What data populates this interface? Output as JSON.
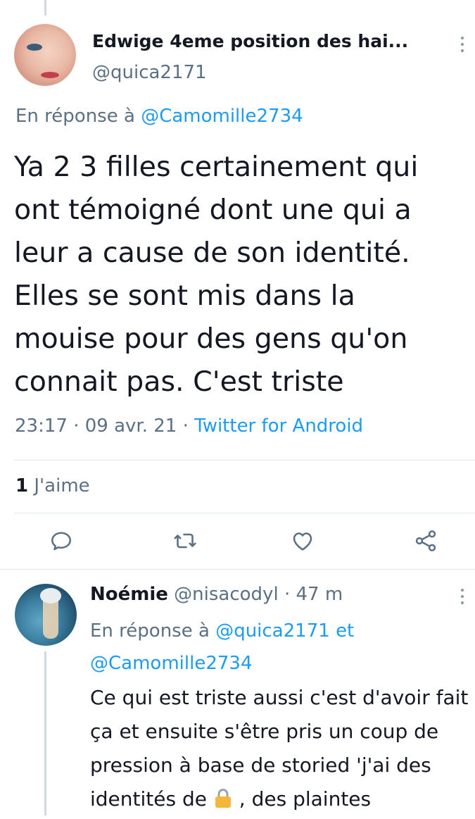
{
  "tweet": {
    "author_name": "Edwige 4eme position des hai...",
    "author_handle": "@quica2171",
    "reply_prefix": "En réponse à",
    "reply_mention": "@Camomille2734",
    "text": "Ya 2 3 filles certainement qui\nont témoigné dont une qui a\nleur a cause de son identité.\nElles se sont mis dans la\nmouise pour des gens qu'on\nconnait pas. C'est triste",
    "time": "23:17 · 09 avr. 21 · ",
    "source": "Twitter for Android",
    "likes_count": "1",
    "likes_label": "J'aime",
    "icons": {
      "more": "more-vertical-icon",
      "reply": "reply-icon",
      "retweet": "retweet-icon",
      "like": "heart-icon",
      "share": "share-icon"
    }
  },
  "reply": {
    "author_name": "Noémie",
    "author_handle": "@nisacodyl",
    "time": "· 47 m",
    "reply_prefix": "En réponse à",
    "reply_mention_1": "@quica2171",
    "reply_connector": "et",
    "reply_mention_2": "@Camomille2734",
    "text_before_emoji": "Ce qui est triste aussi c'est d'avoir fait ça et ensuite s'être pris un coup de pression à base de storied 'j'ai des identités de ",
    "emoji": "lock-icon",
    "text_after_emoji": " , des plaintes"
  },
  "colors": {
    "accent": "#1d9bf0",
    "secondary_text": "#5b7083",
    "divider": "#e1e8ed",
    "lock": "#f4b73b"
  }
}
